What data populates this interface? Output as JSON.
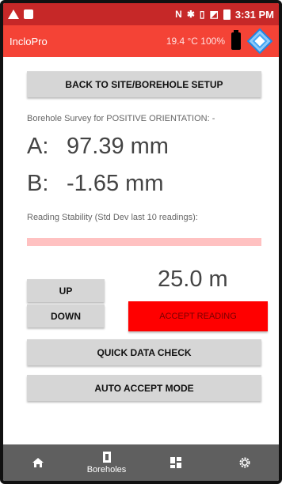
{
  "status_bar": {
    "time": "3:31 PM",
    "icons": [
      "nfc-icon",
      "bluetooth-icon",
      "vibrate-icon",
      "no-sim-icon",
      "battery-icon"
    ]
  },
  "app_bar": {
    "title": "IncloPro",
    "status": "19.4 °C  100%"
  },
  "main": {
    "back_button": "BACK TO SITE/BOREHOLE SETUP",
    "survey_label": "Borehole Survey for POSITIVE ORIENTATION: -",
    "reading_a": {
      "label": "A:",
      "value": "97.39 mm"
    },
    "reading_b": {
      "label": "B:",
      "value": "-1.65 mm"
    },
    "stability_label": "Reading Stability (Std Dev last 10 readings):",
    "stability_level": 1.0,
    "depth": "25.0 m",
    "up_button": "UP",
    "down_button": "DOWN",
    "accept_button": "ACCEPT READING",
    "quick_check_button": "QUICK DATA CHECK",
    "auto_accept_button": "AUTO ACCEPT MODE"
  },
  "bottom_nav": {
    "home": "home-icon",
    "boreholes_label": "Boreholes",
    "grid": "dashboard-icon",
    "settings": "gear-icon"
  },
  "colors": {
    "status_bar": "#c62828",
    "app_bar": "#f44336",
    "accept": "#ff0000",
    "stability": "#ffc1c1",
    "nav": "#5f5f5f"
  }
}
